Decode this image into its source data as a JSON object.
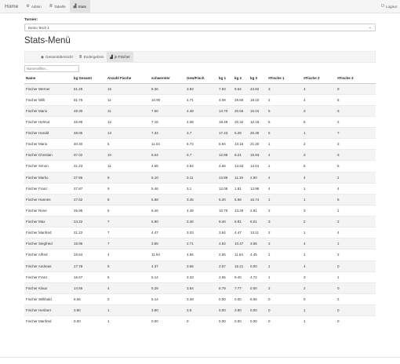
{
  "navbar": {
    "brand": "Home",
    "items": [
      {
        "icon": "gear-icon",
        "glyph": "⚙",
        "label": "Admin"
      },
      {
        "icon": "table-icon",
        "glyph": "≣",
        "label": "Tabelle"
      },
      {
        "icon": "bar-chart-icon",
        "glyph": "▟",
        "label": "Stats"
      }
    ],
    "logout": {
      "icon": "power-icon",
      "glyph": "⏻",
      "label": "Logout"
    }
  },
  "turnier": {
    "label": "Turnier:",
    "selected": "Demo Teich 1"
  },
  "page_title": "Stats-Menü",
  "tabs": [
    {
      "icon": "eye-icon",
      "glyph": "◉",
      "label": "Gesamtübersicht"
    },
    {
      "icon": "list-icon",
      "glyph": "≣",
      "label": "Endergebnis"
    },
    {
      "icon": "bar-chart-icon",
      "glyph": "▟",
      "label": "je Fischer"
    }
  ],
  "filter": {
    "placeholder": "Namensfilter..."
  },
  "table": {
    "headers": [
      "Name",
      "kg Gesamt",
      "Anzahl Fische",
      "schwerster",
      "Gew/Fisch",
      "kg 1",
      "kg 2",
      "kg 3",
      "#Fische 1",
      "#Fische 2",
      "#Fische 3"
    ],
    "rows": [
      [
        "Fischer Werner",
        "61.29",
        "16",
        "8.36",
        "3.83",
        "7.83",
        "9.64",
        "43.82",
        "3",
        "4",
        "9"
      ],
      [
        "Fischer Willi",
        "51.76",
        "11",
        "10.90",
        "4.71",
        "4.08",
        "29.60",
        "18.10",
        "2",
        "4",
        "5"
      ],
      [
        "Fischer Mario",
        "49.30",
        "11",
        "7.50",
        "4.48",
        "13.70",
        "20.56",
        "15.04",
        "5",
        "3",
        "3"
      ],
      [
        "Fischer Helmut",
        "48.99",
        "12",
        "7.16",
        "4.08",
        "18.49",
        "20.32",
        "10.18",
        "5",
        "5",
        "2"
      ],
      [
        "Fischer Harald",
        "48.06",
        "13",
        "7.34",
        "3.7",
        "17.43",
        "5.28",
        "25.35",
        "5",
        "1",
        "7"
      ],
      [
        "Fischer Mario",
        "40.30",
        "6",
        "11.04",
        "6.72",
        "5.94",
        "13.16",
        "21.20",
        "1",
        "2",
        "3"
      ],
      [
        "Fischer Christian",
        "37.02",
        "10",
        "6.04",
        "3.7",
        "12.88",
        "8.21",
        "15.93",
        "4",
        "3",
        "3"
      ],
      [
        "Fischer Simon",
        "31.23",
        "11",
        "4.66",
        "2.84",
        "4.66",
        "13.53",
        "13.04",
        "1",
        "5",
        "5"
      ],
      [
        "Fischer Marko",
        "27.95",
        "9",
        "5.10",
        "3.11",
        "13.86",
        "11.19",
        "2.90",
        "4",
        "4",
        "1"
      ],
      [
        "Fischer Franz",
        "27.87",
        "9",
        "5.46",
        "3.1",
        "12.08",
        "1.81",
        "13.98",
        "4",
        "1",
        "4"
      ],
      [
        "Fischer Hannes",
        "27.62",
        "8",
        "5.68",
        "3.45",
        "5.20",
        "5.68",
        "16.74",
        "1",
        "1",
        "6"
      ],
      [
        "Fischer Rene",
        "26.95",
        "6",
        "6.46",
        "4.49",
        "10.75",
        "13.29",
        "2.91",
        "2",
        "3",
        "1"
      ],
      [
        "Fischer Max",
        "24.22",
        "7",
        "5.80",
        "3.46",
        "9.40",
        "6.81",
        "8.01",
        "3",
        "2",
        "2"
      ],
      [
        "Fischer Manfred",
        "21.22",
        "7",
        "4.47",
        "3.03",
        "3.64",
        "4.47",
        "13.11",
        "2",
        "1",
        "4"
      ],
      [
        "Fischer Siegfried",
        "18.96",
        "7",
        "3.65",
        "2.71",
        "4.84",
        "10.47",
        "3.65",
        "2",
        "4",
        "1"
      ],
      [
        "Fischer Alfred",
        "18.64",
        "4",
        "11.64",
        "4.66",
        "2.55",
        "11.64",
        "4.45",
        "1",
        "1",
        "2"
      ],
      [
        "Fischer Andreas",
        "17.78",
        "5",
        "4.37",
        "3.56",
        "2.57",
        "15.21",
        "0.00",
        "1",
        "4",
        "0"
      ],
      [
        "Fischer Franz",
        "16.67",
        "5",
        "5.14",
        "3.33",
        "2.55",
        "9.40",
        "4.72",
        "1",
        "3",
        "1"
      ],
      [
        "Fischer Klaus",
        "14.56",
        "4",
        "5.28",
        "3.64",
        "6.79",
        "7.77",
        "0.00",
        "2",
        "2",
        "0"
      ],
      [
        "Fischer Willibald",
        "6.56",
        "2",
        "5.14",
        "3.28",
        "0.00",
        "0.00",
        "6.56",
        "0",
        "0",
        "2"
      ],
      [
        "Fischer Heribert",
        "3.90",
        "1",
        "3.90",
        "3.9",
        "0.00",
        "3.90",
        "0.00",
        "0",
        "1",
        "0"
      ],
      [
        "Fischer Manfred",
        "0.00",
        "1",
        "0.00",
        "0",
        "0.00",
        "0.00",
        "0.00",
        "0",
        "1",
        "0"
      ]
    ]
  }
}
